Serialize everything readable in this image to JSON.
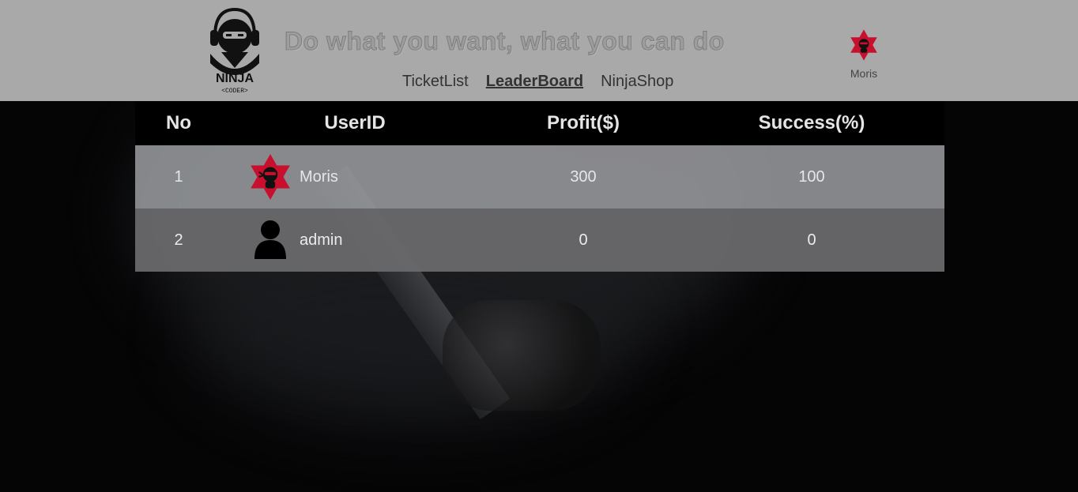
{
  "header": {
    "tagline": "Do what you want, what you can do",
    "nav": [
      {
        "label": "TicketList",
        "active": false
      },
      {
        "label": "LeaderBoard",
        "active": true
      },
      {
        "label": "NinjaShop",
        "active": false
      }
    ],
    "user": {
      "name": "Moris",
      "avatar": "ninja-star-avatar-icon"
    },
    "logo": {
      "text": "NINJA",
      "subtext": "<CODER>"
    }
  },
  "leaderboard": {
    "columns": [
      "No",
      "UserID",
      "Profit($)",
      "Success(%)"
    ],
    "rows": [
      {
        "no": "1",
        "user": "Moris",
        "avatar": "ninja-star-avatar-icon",
        "profit": "300",
        "success": "100"
      },
      {
        "no": "2",
        "user": "admin",
        "avatar": "default-user-icon",
        "profit": "0",
        "success": "0"
      }
    ]
  },
  "colors": {
    "header_bg": "#a9a9a9",
    "table_head_bg": "#000000",
    "row1_bg": "#96989c",
    "row2_bg": "#69696b",
    "avatar_red": "#c8102e"
  }
}
